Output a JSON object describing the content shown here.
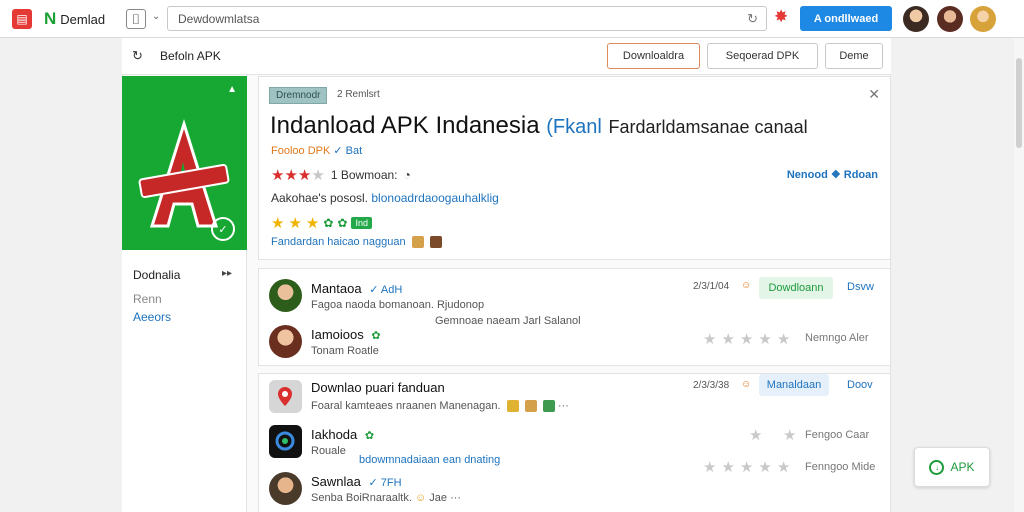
{
  "topbar": {
    "brand": "Demlad",
    "search_text": "Dewdowmlatsa",
    "cta_label": "A ondllwaed"
  },
  "subheader": {
    "title": "Befoln APK",
    "btn_download": "Downloaldra",
    "btn_supported": "Seqoerad DPK",
    "btn_demo": "Deme"
  },
  "app_card": {
    "tag": "Dremnodr",
    "tag_sub": "2 Remlsrt",
    "title_main": "Indanload APK Indanesia",
    "title_blue": "(Fkanl",
    "title_rest": "Fardarldamsanae canaal",
    "dev_line": "Fooloo DPK",
    "dev_extra": "Bat",
    "rating_text": "1 Bowmoan:",
    "report_link": "Nenood ❖ Rdoan",
    "desc_prefix": "Aakohae's pososl.",
    "desc_blue": "blonoadrdaoogauhalklig",
    "green_badge": "Ind",
    "features_line": "Fandardan haicao nagguan",
    "stars_primary": 3,
    "stars_secondary": 3
  },
  "sidebar": {
    "item1": "Dodnalia",
    "item2": "Renn",
    "item3": "Aeeors"
  },
  "reviews_list_1": [
    {
      "name": "Mantaoa",
      "ver": "AdH",
      "subtitle": "Fagoa naoda bomanoan. Rjudonop",
      "time": "2/3/1/04",
      "button": "Dowdloann",
      "link": "Dsvw"
    },
    {
      "name": "Iamoioos",
      "subtitle": "Tonam Roatle",
      "center_text": "Gemnoae naeam Jarl Salanol",
      "right_text": "Nemngo  Aler"
    }
  ],
  "reviews_list_2": [
    {
      "name": "Downlao puari fanduan",
      "subtitle": "Foaral kamteaes nraanen Manenagan.",
      "time": "2/3/3/38",
      "button": "Manaldaan",
      "link": "Doov"
    },
    {
      "name": "Iakhoda",
      "subtitle": "Rouale",
      "right_text": "Fengoo  Caar"
    },
    {
      "name": "Sawnlaa",
      "ver": "7FH",
      "subtitle": "Senba BoiRnaraaltk.",
      "subtitle_end": "Jae",
      "center_text": "bdowmnadaiaan ean dnating",
      "right_text": "Fenngoo  Mide"
    }
  ],
  "float_button": "APK"
}
